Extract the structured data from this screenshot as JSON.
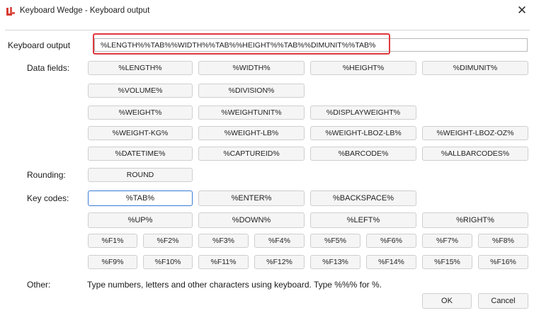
{
  "window": {
    "title": "Keyboard Wedge - Keyboard output",
    "close_glyph": "✕"
  },
  "keyboard_output": {
    "label": "Keyboard output",
    "value": "%LENGTH%%TAB%%WIDTH%%TAB%%HEIGHT%%TAB%%DIMUNIT%%TAB%"
  },
  "data_fields": {
    "label": "Data fields:",
    "buttons": [
      "%LENGTH%",
      "%WIDTH%",
      "%HEIGHT%",
      "%DIMUNIT%",
      "%VOLUME%",
      "%DIVISION%",
      "%WEIGHT%",
      "%WEIGHTUNIT%",
      "%DISPLAYWEIGHT%",
      "%WEIGHT-KG%",
      "%WEIGHT-LB%",
      "%WEIGHT-LBOZ-LB%",
      "%WEIGHT-LBOZ-OZ%",
      "%DATETIME%",
      "%CAPTUREID%",
      "%BARCODE%",
      "%ALLBARCODES%"
    ]
  },
  "rounding": {
    "label": "Rounding:",
    "button": "ROUND"
  },
  "key_codes": {
    "label": "Key codes:",
    "buttons": [
      "%TAB%",
      "%ENTER%",
      "%BACKSPACE%",
      "%UP%",
      "%DOWN%",
      "%LEFT%",
      "%RIGHT%"
    ],
    "fkeys": [
      "%F1%",
      "%F2%",
      "%F3%",
      "%F4%",
      "%F5%",
      "%F6%",
      "%F7%",
      "%F8%",
      "%F9%",
      "%F10%",
      "%F11%",
      "%F12%",
      "%F13%",
      "%F14%",
      "%F15%",
      "%F16%"
    ]
  },
  "other": {
    "label": "Other:",
    "text": "Type numbers, letters and other characters using keyboard. Type %%% for %."
  },
  "footer": {
    "ok_label": "OK",
    "cancel_label": "Cancel"
  },
  "colors": {
    "highlight": "#e0383e",
    "focus": "#3a7bd5",
    "app_icon": "#d83a2f"
  },
  "icons": {
    "app": "keyboard-wedge-logo-icon",
    "close": "close-icon"
  }
}
